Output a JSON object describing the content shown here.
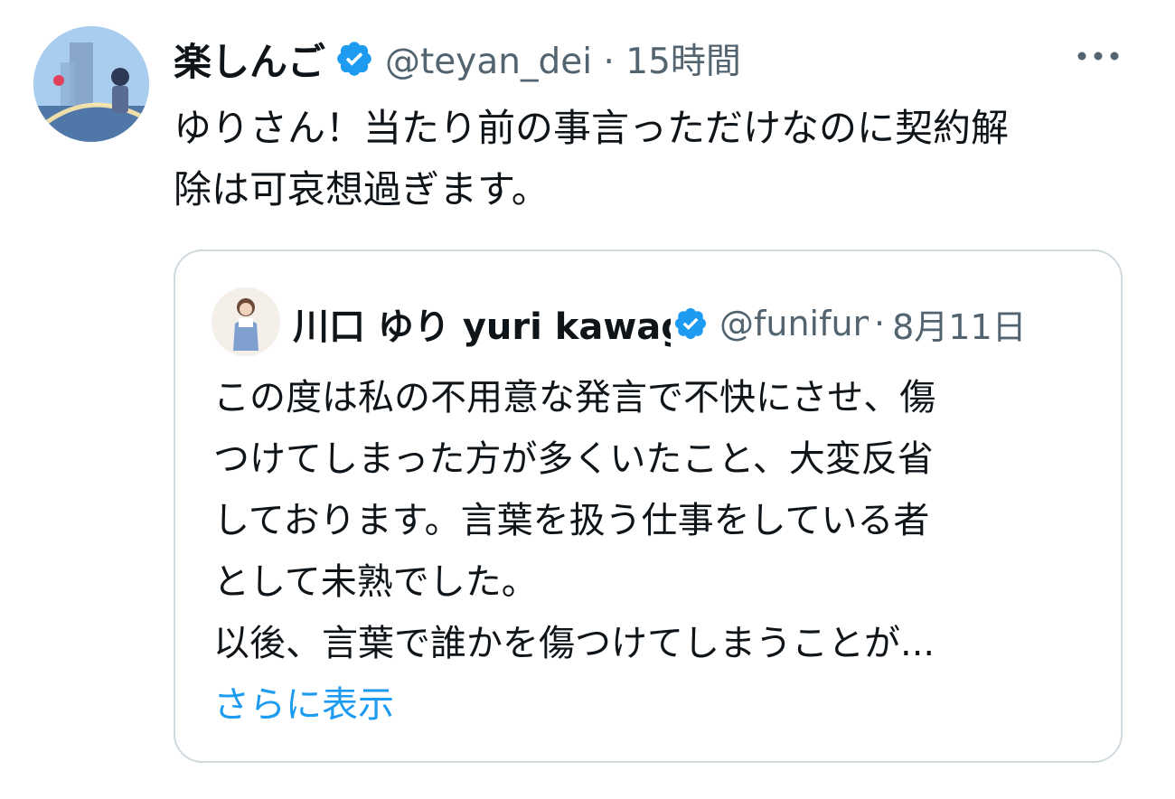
{
  "tweet": {
    "author": {
      "name": "楽しんご",
      "verified": true
    },
    "meta": "@teyan_dei · 15時間",
    "text_lines": [
      "ゆりさん！当たり前の事言っただけなのに契約解",
      "除は可哀想過ぎます。"
    ],
    "more_icon": "more-horizontal-icon"
  },
  "quote": {
    "author": {
      "name": "川口 ゆり yuri kawaguchi",
      "verified": true
    },
    "handle": "@funifuni",
    "separator": "·",
    "date": "8月11日",
    "text_lines": [
      "この度は私の不用意な発言で不快にさせ、傷",
      "つけてしまった方が多くいたこと、大変反省",
      "しております。言葉を扱う仕事をしている者",
      "として未熟でした。",
      "以後、言葉で誰かを傷つけてしまうことが..."
    ],
    "show_more": "さらに表示"
  },
  "colors": {
    "accent": "#1d9bf0",
    "secondary_text": "#536471",
    "border": "#cfd9de"
  }
}
